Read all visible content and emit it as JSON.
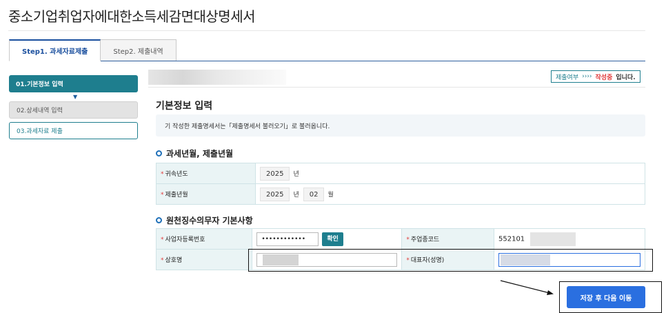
{
  "page": {
    "title": "중소기업취업자에대한소득세감면대상명세서"
  },
  "tabs": [
    {
      "label": "Step1. 과세자료제출",
      "active": true
    },
    {
      "label": "Step2. 제출내역",
      "active": false
    }
  ],
  "sidebar": {
    "items": [
      {
        "label": "01.기본정보 입력",
        "state": "active"
      },
      {
        "label": "02.상세내역 입력",
        "state": "disabled"
      },
      {
        "label": "03.과세자료 제출",
        "state": "outlined"
      }
    ],
    "arrow_glyph": "▼"
  },
  "status": {
    "prefix": "제출여부",
    "arrows": "››››",
    "state": "작성중",
    "suffix": "입니다."
  },
  "basic": {
    "title": "기본정보 입력",
    "notice": "기 작성한 제출명세서는「제출명세서 불러오기」로 불러옵니다."
  },
  "period": {
    "title": "과세년월, 제출년월",
    "rows": [
      {
        "label": "귀속년도",
        "year": "2025",
        "year_unit": "년"
      },
      {
        "label": "제출년월",
        "year": "2025",
        "year_unit": "년",
        "month": "02",
        "month_unit": "월"
      }
    ]
  },
  "withholder": {
    "title": "원천징수의무자 기본사항",
    "business_no_label": "사업자등록번호",
    "business_no_value": "••••••••••••",
    "confirm_label": "확인",
    "industry_code_label": "주업종코드",
    "industry_code_value": "552101",
    "company_name_label": "상호명",
    "representative_label": "대표자(성명)"
  },
  "actions": {
    "save_next_label": "저장 후 다음 이동"
  },
  "colors": {
    "teal": "#1e7e8e",
    "blue_button": "#2a6fe0",
    "tab_blue": "#1a4f9e",
    "status_red": "#e03a3a"
  },
  "icons": {
    "section_bullet": "ring-bullet-icon",
    "arrow": "arrow-pointer-icon"
  }
}
